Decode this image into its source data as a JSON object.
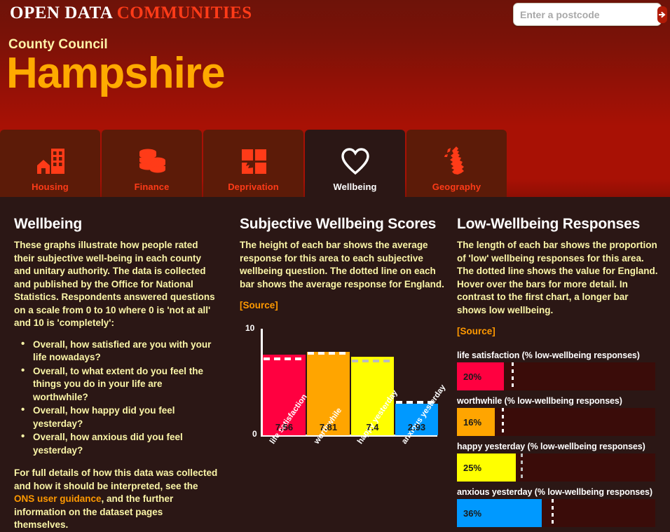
{
  "brand": {
    "part1": "OPEN DATA",
    "part2": "COMMUNITIES"
  },
  "search": {
    "placeholder": "Enter a postcode",
    "value": "",
    "button_icon": "arrow-right-icon"
  },
  "area": {
    "type": "County Council",
    "name": "Hampshire"
  },
  "tabs": [
    {
      "label": "Housing",
      "icon": "building-icon",
      "active": false
    },
    {
      "label": "Finance",
      "icon": "coins-icon",
      "active": false
    },
    {
      "label": "Deprivation",
      "icon": "broken-grid-icon",
      "active": false
    },
    {
      "label": "Wellbeing",
      "icon": "heart-icon",
      "active": true
    },
    {
      "label": "Geography",
      "icon": "uk-map-icon",
      "active": false
    }
  ],
  "left": {
    "title": "Wellbeing",
    "intro": "These graphs illustrate how people rated their subjective well-being in each county and unitary authority. The data is collected and published by the Office for National Statistics. Respondents answered questions on a scale from 0 to 10 where 0 is 'not at all' and 10 is 'completely':",
    "questions": [
      "Overall, how satisfied are you with your life nowadays?",
      "Overall, to what extent do you feel the things you do in your life are worthwhile?",
      "Overall, how happy did you feel yesterday?",
      "Overall, how anxious did you feel yesterday?"
    ],
    "footer_pre": "For full details of how this data was collected and how it should be interpreted, see the ",
    "footer_link": "ONS user guidance",
    "footer_post": ", and the further information on the dataset pages themselves."
  },
  "middle": {
    "title": "Subjective Wellbeing Scores",
    "description": "The height of each bar shows the average response for this area to each subjective wellbeing question. The dotted line on each bar shows the average response for England.",
    "source_label": "[Source]"
  },
  "right": {
    "title": "Low-Wellbeing Responses",
    "description": "The length of each bar shows the proportion of 'low' wellbeing responses for this area. The dotted line shows the value for England. Hover over the bars for more detail. In contrast to the first chart, a longer bar shows low wellbeing.",
    "source_label": "[Source]"
  },
  "chart_data": [
    {
      "type": "bar",
      "title": "Subjective Wellbeing Scores",
      "orientation": "vertical",
      "categories": [
        "life satisfaction",
        "worthwhile",
        "happy yesterday",
        "anxious yesterday"
      ],
      "values": [
        7.56,
        7.81,
        7.4,
        2.93
      ],
      "value_labels": [
        "7.56",
        "7.81",
        "7.4",
        "2.93"
      ],
      "england_reference": [
        7.38,
        7.81,
        7.2,
        3.05
      ],
      "colors": [
        "#FF0040",
        "#FFA500",
        "#FFFF00",
        "#0099FF"
      ],
      "reference_line_colors": [
        "#FFFFFF",
        "#FFFFFF",
        "#BDBDBD",
        "#FFFFFF"
      ],
      "xlabel": "",
      "ylabel": "",
      "ylim": [
        0,
        10
      ],
      "ytick_labels": [
        "10",
        "0"
      ],
      "grid": false,
      "legend": false
    },
    {
      "type": "bar",
      "title": "Low-Wellbeing Responses",
      "orientation": "horizontal",
      "categories": [
        "life satisfaction (% low-wellbeing responses)",
        "worthwhile (% low-wellbeing responses)",
        "happy yesterday (% low-wellbeing responses)",
        "anxious yesterday (% low-wellbeing responses)"
      ],
      "values": [
        20,
        16,
        25,
        36
      ],
      "value_labels": [
        "20%",
        "16%",
        "25%",
        "36%"
      ],
      "england_reference": [
        23,
        19,
        27,
        40
      ],
      "colors": [
        "#FF0040",
        "#FFA500",
        "#FFFF00",
        "#0099FF"
      ],
      "reference_line_colors": [
        "#FFFFFF",
        "#FFFFFF",
        "#BDBDBD",
        "#FFFFFF"
      ],
      "xlim": [
        0,
        84
      ],
      "unit": "%",
      "grid": false,
      "legend": false
    }
  ]
}
